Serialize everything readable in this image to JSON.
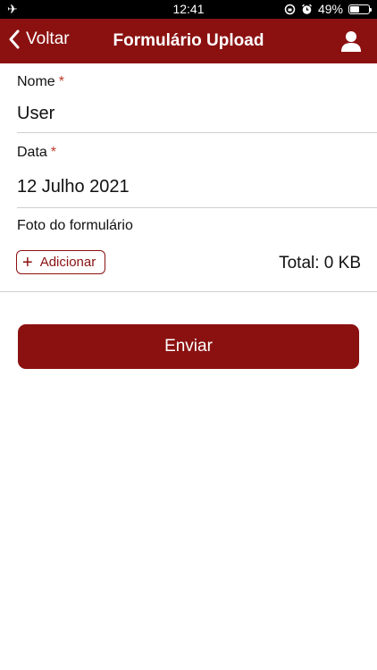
{
  "status_bar": {
    "time": "12:41",
    "battery_percent": "49%",
    "battery_level": 0.49,
    "icons": [
      "airplane-icon",
      "orientation-lock-icon",
      "alarm-icon",
      "battery-icon"
    ]
  },
  "nav": {
    "back_label": "Voltar",
    "title": "Formulário Upload",
    "color": "#8b1111"
  },
  "form": {
    "name_label": "Nome",
    "name_value": "User",
    "date_label": "Data",
    "date_value": "12 Julho 2021",
    "required_mark": "*",
    "photo_label": "Foto do formulário",
    "add_button_label": "Adicionar",
    "total_label": "Total: 0 KB",
    "submit_label": "Enviar"
  }
}
